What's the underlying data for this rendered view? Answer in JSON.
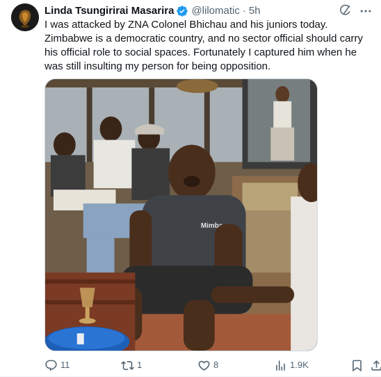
{
  "author": {
    "display_name": "Linda Tsungirirai Masarira",
    "handle": "@lilomatic",
    "separator": "·",
    "time": "5h",
    "verified": true
  },
  "tweet": {
    "text": "I was attacked by ZNA Colonel Bhichau and his juniors today. Zimbabwe is a democratic country, and no sector official should carry his official role to social spaces. Fortunately I captured him when he was still insulting my person for being opposition."
  },
  "media": {
    "shirt_text": "Mimba"
  },
  "actions": {
    "replies": "11",
    "reposts": "1",
    "likes": "8",
    "views": "1.9K"
  },
  "icons": {
    "verified": "verified-badge-icon",
    "grok": "grok-icon",
    "more": "more-icon",
    "reply": "reply-icon",
    "repost": "repost-icon",
    "like": "heart-icon",
    "views": "views-icon",
    "bookmark": "bookmark-icon",
    "share": "share-icon"
  },
  "colors": {
    "text": "#0f1419",
    "secondary": "#536471",
    "verified": "#1d9bf0",
    "border": "#cfd9de"
  }
}
